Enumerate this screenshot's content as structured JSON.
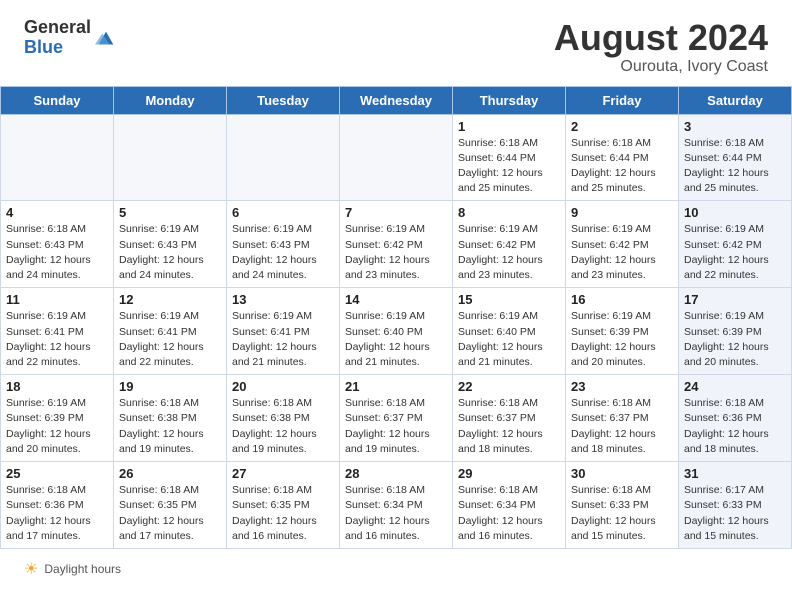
{
  "header": {
    "logo_general": "General",
    "logo_blue": "Blue",
    "title": "August 2024",
    "subtitle": "Ourouta, Ivory Coast"
  },
  "calendar": {
    "days_of_week": [
      "Sunday",
      "Monday",
      "Tuesday",
      "Wednesday",
      "Thursday",
      "Friday",
      "Saturday"
    ],
    "weeks": [
      [
        {
          "day": "",
          "empty": true
        },
        {
          "day": "",
          "empty": true
        },
        {
          "day": "",
          "empty": true
        },
        {
          "day": "",
          "empty": true
        },
        {
          "day": "1",
          "info": "Sunrise: 6:18 AM\nSunset: 6:44 PM\nDaylight: 12 hours\nand 25 minutes."
        },
        {
          "day": "2",
          "info": "Sunrise: 6:18 AM\nSunset: 6:44 PM\nDaylight: 12 hours\nand 25 minutes."
        },
        {
          "day": "3",
          "shaded": true,
          "info": "Sunrise: 6:18 AM\nSunset: 6:44 PM\nDaylight: 12 hours\nand 25 minutes."
        }
      ],
      [
        {
          "day": "4",
          "info": "Sunrise: 6:18 AM\nSunset: 6:43 PM\nDaylight: 12 hours\nand 24 minutes."
        },
        {
          "day": "5",
          "info": "Sunrise: 6:19 AM\nSunset: 6:43 PM\nDaylight: 12 hours\nand 24 minutes."
        },
        {
          "day": "6",
          "info": "Sunrise: 6:19 AM\nSunset: 6:43 PM\nDaylight: 12 hours\nand 24 minutes."
        },
        {
          "day": "7",
          "info": "Sunrise: 6:19 AM\nSunset: 6:42 PM\nDaylight: 12 hours\nand 23 minutes."
        },
        {
          "day": "8",
          "info": "Sunrise: 6:19 AM\nSunset: 6:42 PM\nDaylight: 12 hours\nand 23 minutes."
        },
        {
          "day": "9",
          "info": "Sunrise: 6:19 AM\nSunset: 6:42 PM\nDaylight: 12 hours\nand 23 minutes."
        },
        {
          "day": "10",
          "shaded": true,
          "info": "Sunrise: 6:19 AM\nSunset: 6:42 PM\nDaylight: 12 hours\nand 22 minutes."
        }
      ],
      [
        {
          "day": "11",
          "info": "Sunrise: 6:19 AM\nSunset: 6:41 PM\nDaylight: 12 hours\nand 22 minutes."
        },
        {
          "day": "12",
          "info": "Sunrise: 6:19 AM\nSunset: 6:41 PM\nDaylight: 12 hours\nand 22 minutes."
        },
        {
          "day": "13",
          "info": "Sunrise: 6:19 AM\nSunset: 6:41 PM\nDaylight: 12 hours\nand 21 minutes."
        },
        {
          "day": "14",
          "info": "Sunrise: 6:19 AM\nSunset: 6:40 PM\nDaylight: 12 hours\nand 21 minutes."
        },
        {
          "day": "15",
          "info": "Sunrise: 6:19 AM\nSunset: 6:40 PM\nDaylight: 12 hours\nand 21 minutes."
        },
        {
          "day": "16",
          "info": "Sunrise: 6:19 AM\nSunset: 6:39 PM\nDaylight: 12 hours\nand 20 minutes."
        },
        {
          "day": "17",
          "shaded": true,
          "info": "Sunrise: 6:19 AM\nSunset: 6:39 PM\nDaylight: 12 hours\nand 20 minutes."
        }
      ],
      [
        {
          "day": "18",
          "info": "Sunrise: 6:19 AM\nSunset: 6:39 PM\nDaylight: 12 hours\nand 20 minutes."
        },
        {
          "day": "19",
          "info": "Sunrise: 6:18 AM\nSunset: 6:38 PM\nDaylight: 12 hours\nand 19 minutes."
        },
        {
          "day": "20",
          "info": "Sunrise: 6:18 AM\nSunset: 6:38 PM\nDaylight: 12 hours\nand 19 minutes."
        },
        {
          "day": "21",
          "info": "Sunrise: 6:18 AM\nSunset: 6:37 PM\nDaylight: 12 hours\nand 19 minutes."
        },
        {
          "day": "22",
          "info": "Sunrise: 6:18 AM\nSunset: 6:37 PM\nDaylight: 12 hours\nand 18 minutes."
        },
        {
          "day": "23",
          "info": "Sunrise: 6:18 AM\nSunset: 6:37 PM\nDaylight: 12 hours\nand 18 minutes."
        },
        {
          "day": "24",
          "shaded": true,
          "info": "Sunrise: 6:18 AM\nSunset: 6:36 PM\nDaylight: 12 hours\nand 18 minutes."
        }
      ],
      [
        {
          "day": "25",
          "info": "Sunrise: 6:18 AM\nSunset: 6:36 PM\nDaylight: 12 hours\nand 17 minutes."
        },
        {
          "day": "26",
          "info": "Sunrise: 6:18 AM\nSunset: 6:35 PM\nDaylight: 12 hours\nand 17 minutes."
        },
        {
          "day": "27",
          "info": "Sunrise: 6:18 AM\nSunset: 6:35 PM\nDaylight: 12 hours\nand 16 minutes."
        },
        {
          "day": "28",
          "info": "Sunrise: 6:18 AM\nSunset: 6:34 PM\nDaylight: 12 hours\nand 16 minutes."
        },
        {
          "day": "29",
          "info": "Sunrise: 6:18 AM\nSunset: 6:34 PM\nDaylight: 12 hours\nand 16 minutes."
        },
        {
          "day": "30",
          "info": "Sunrise: 6:18 AM\nSunset: 6:33 PM\nDaylight: 12 hours\nand 15 minutes."
        },
        {
          "day": "31",
          "shaded": true,
          "info": "Sunrise: 6:17 AM\nSunset: 6:33 PM\nDaylight: 12 hours\nand 15 minutes."
        }
      ]
    ]
  },
  "footer": {
    "sun_symbol": "☀",
    "label": "Daylight hours"
  }
}
